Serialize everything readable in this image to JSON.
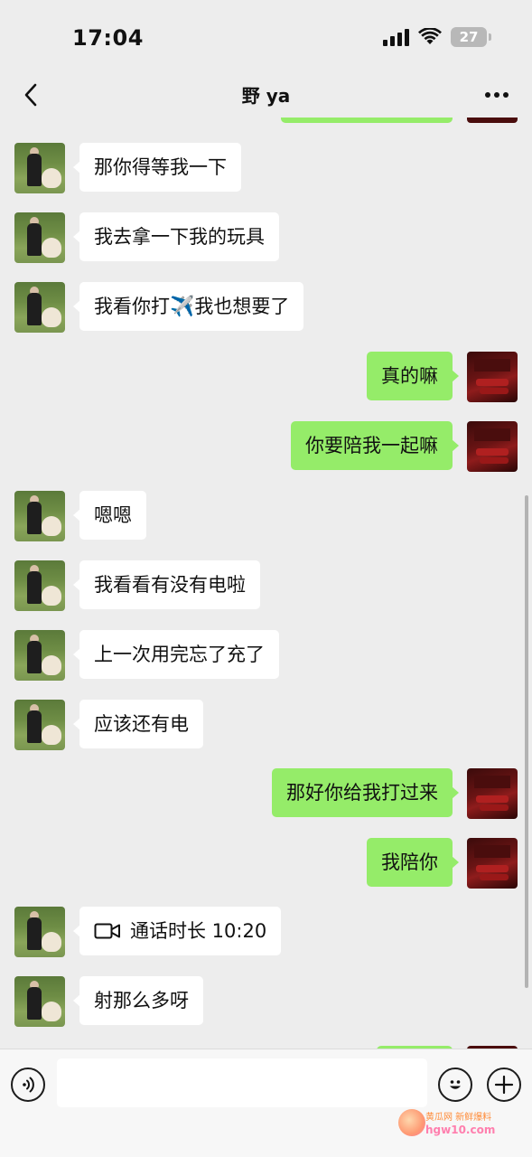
{
  "status_bar": {
    "time": "17:04",
    "battery": "27",
    "icons": [
      "signal-icon",
      "wifi-icon",
      "battery-icon"
    ]
  },
  "nav": {
    "title": "野 ya",
    "back_icon": "chevron-left-icon",
    "more_icon": "more-dots-icon"
  },
  "messages": [
    {
      "side": "left",
      "text": "那你得等我一下"
    },
    {
      "side": "left",
      "text": "我去拿一下我的玩具"
    },
    {
      "side": "left",
      "text_before": "我看你打",
      "emoji": "✈️",
      "text_after": "我也想要了"
    },
    {
      "side": "right",
      "text": "真的嘛"
    },
    {
      "side": "right",
      "text": "你要陪我一起嘛"
    },
    {
      "side": "left",
      "text": "嗯嗯"
    },
    {
      "side": "left",
      "text": "我看看有没有电啦"
    },
    {
      "side": "left",
      "text": "上一次用完忘了充了"
    },
    {
      "side": "left",
      "text": "应该还有电"
    },
    {
      "side": "right",
      "text": "那好你给我打过来"
    },
    {
      "side": "right",
      "text": "我陪你"
    },
    {
      "side": "left",
      "type": "video-call",
      "text": "通话时长 10:20",
      "icon": "video-camera-icon"
    },
    {
      "side": "left",
      "text": "射那么多呀"
    }
  ],
  "input_bar": {
    "voice_icon": "voice-icon",
    "emoji_icon": "emoji-icon",
    "plus_icon": "plus-icon",
    "value": ""
  },
  "watermark": {
    "line1": "黄瓜网 新鲜爆料",
    "line2": "hgw10.com"
  },
  "colors": {
    "background": "#ededed",
    "sent_bubble": "#95ec69",
    "received_bubble": "#ffffff",
    "input_bar": "#f7f7f7"
  }
}
